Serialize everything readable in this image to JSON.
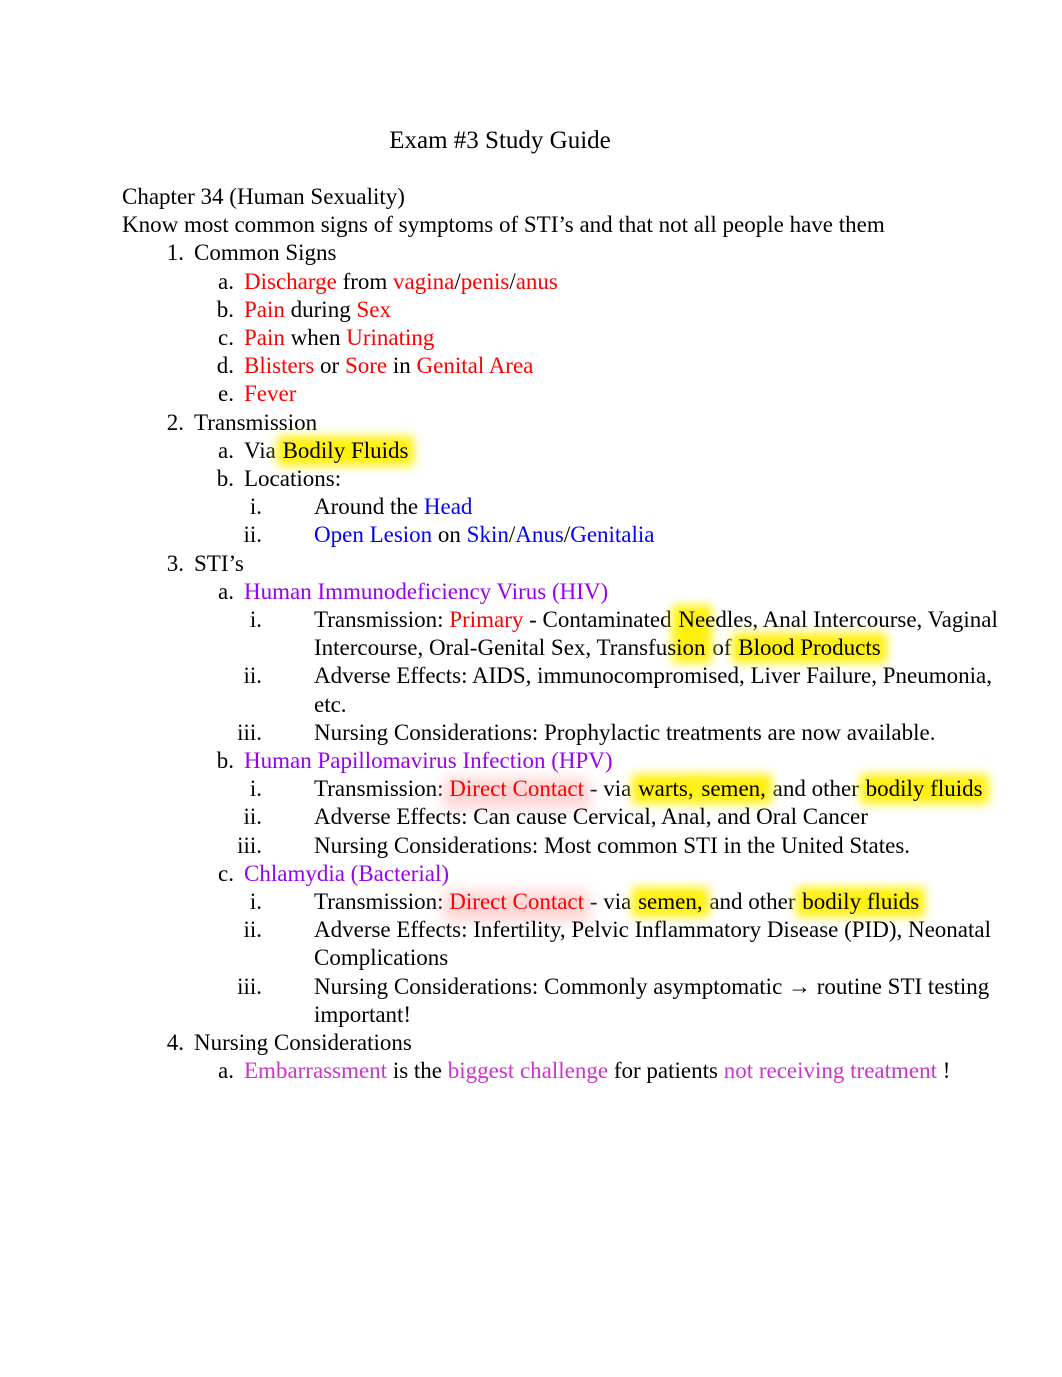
{
  "document": {
    "title": "Exam #3 Study Guide",
    "chapter_heading": "Chapter 34 (Human Sexuality)",
    "intro_line": "Know most common signs of symptoms of STI’s and that not all people have them"
  },
  "colors": {
    "red": "#ff0000",
    "blue": "#0000ff",
    "purple": "#9900ee",
    "magenta": "#cc33cc",
    "highlight_yellow": "#fff000",
    "text": "#000000",
    "page_background": "#ffffff"
  },
  "markers": {
    "n1": "1.",
    "n2": "2.",
    "n3": "3.",
    "n4": "4.",
    "a": "a.",
    "b": "b.",
    "c": "c.",
    "d": "d.",
    "e": "e.",
    "i": "i.",
    "ii": "ii.",
    "iii": "iii."
  },
  "sections": {
    "common_signs": {
      "heading": "Common  Signs",
      "a": {
        "discharge": "Discharge",
        "from": "  from ",
        "vagina": "vagina",
        "slash1": "/",
        "penis": "penis",
        "slash2": "/",
        "anus": "anus"
      },
      "b": {
        "pain": "Pain",
        "during": "  during  ",
        "sex": "Sex"
      },
      "c": {
        "pain": "Pain",
        "when": "  when ",
        "urinating": "Urinating"
      },
      "d": {
        "blisters": "Blisters",
        "or": " or ",
        "sore": "Sore",
        "in": " in ",
        "genital_area": "Genital Area"
      },
      "e": {
        "fever": "Fever"
      }
    },
    "transmission": {
      "heading": "Transmission",
      "a": {
        "via": "Via ",
        "bodily_fluids": "Bodily Fluids"
      },
      "b": {
        "locations": "Locations:",
        "i": {
          "around_the": "Around the ",
          "head": "Head"
        },
        "ii": {
          "open_lesion": "Open Lesion",
          "on": "  on ",
          "skin": "Skin",
          "slash1": "/",
          "anus": "Anus",
          "slash2": "/",
          "genitalia": "Genitalia"
        }
      }
    },
    "stis": {
      "heading": "STI’s",
      "items": {
        "hiv": {
          "name": "Human Immunodeficiency Virus (HIV)",
          "transmission": {
            "label": "Transmission:  ",
            "primary": "Primary",
            "dash": " - Contaminated ",
            "highlighted": "Needles, Anal Intercourse, Vaginal Intercourse, Oral-Genital Sex, Transfusion",
            "of": " of ",
            "highlighted2": "Blood Products"
          },
          "adverse_effects": "Adverse Effects: AIDS, immunocompromised, Liver Failure, Pneumonia, etc.",
          "nursing": "Nursing Considerations:   Prophylactic treatments are now available."
        },
        "hpv": {
          "name": "Human Papillomavirus Infection (HPV)",
          "transmission": {
            "label": "Transmission:  ",
            "direct_contact": "Direct Contact",
            "dash": " - via ",
            "warts": "warts,",
            "space": " ",
            "semen": "semen,",
            "and_other": " and other ",
            "bodily_fluids": "bodily fluids"
          },
          "adverse_effects": "Adverse Effects: Can cause Cervical, Anal, and Oral Cancer",
          "nursing": "Nursing Considerations:   Most common STI in the United States."
        },
        "chlamydia": {
          "name": "Chlamydia (Bacterial)",
          "transmission": {
            "label": "Transmission:  ",
            "direct_contact": "Direct Contact",
            "dash": " - via ",
            "semen": "semen,",
            "and_other": " and other ",
            "bodily": "bodily fluids"
          },
          "adverse_effects": "Adverse Effects: Infertility, Pelvic Inflammatory Disease (PID), Neonatal Complications",
          "nursing": "Nursing Considerations:   Commonly asymptomatic → routine STI testing important!"
        }
      }
    },
    "nursing_considerations": {
      "heading": "Nursing  Considerations",
      "a": {
        "embarrassment": "Embarrassment",
        "is_the": "   is the ",
        "biggest_challenge": "biggest challenge",
        "for_patients": "  for patients ",
        "not_receiving_treatment": "not receiving treatment",
        "bang": " !"
      }
    }
  }
}
